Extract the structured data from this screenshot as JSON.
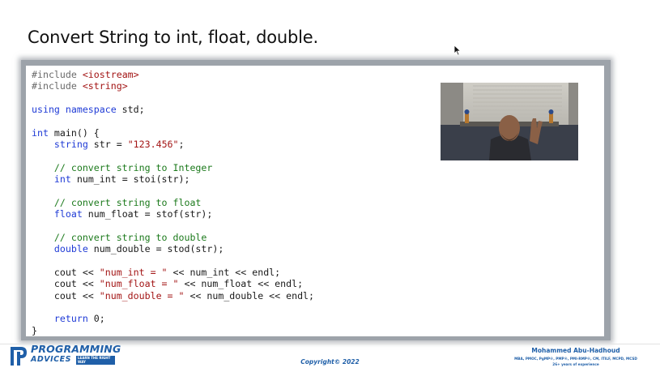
{
  "slide": {
    "title": "Convert String to int, float, double."
  },
  "code": {
    "line1_directive": "#include",
    "line1_header": "<iostream>",
    "line2_directive": "#include",
    "line2_header": "<string>",
    "using_kw": "using namespace",
    "using_rest": " std;",
    "main_kw": "int",
    "main_rest": " main() {",
    "str_type": "string",
    "str_decl": " str = ",
    "str_value": "\"123.456\"",
    "str_end": ";",
    "comment_int": "// convert string to Integer",
    "int_type": "int",
    "int_decl": " num_int = stoi(str);",
    "comment_float": "// convert string to float",
    "float_type": "float",
    "float_decl": " num_float = stof(str);",
    "comment_double": "// convert string to double",
    "double_type": "double",
    "double_decl": " num_double = stod(str);",
    "cout1_a": "cout << ",
    "cout1_str": "\"num_int = \"",
    "cout1_b": " << num_int << endl;",
    "cout2_a": "cout << ",
    "cout2_str": "\"num_float = \"",
    "cout2_b": " << num_float << endl;",
    "cout3_a": "cout << ",
    "cout3_str": "\"num_double = \"",
    "cout3_b": " << num_double << endl;",
    "return_kw": "return",
    "return_rest": " 0;",
    "close_brace": "}"
  },
  "footer": {
    "logo_line1": "PROGRAMMING",
    "logo_line2": "ADVICES",
    "logo_tag": "LEARN THE RIGHT WAY",
    "copyright": "Copyright© 2022",
    "author_name": "Mohammed Abu-Hadhoud",
    "author_credentials": "MBA, PMOC, PgMP®, PMP®, PMI-RMP®, CM, ITILF, MCPD, MCSD",
    "author_experience": "26+ years of experience"
  },
  "colors": {
    "keyword": "#1f3bd6",
    "string": "#a31515",
    "comment": "#1c7a1c",
    "brand": "#1f5fa8"
  },
  "icons": [
    "mouse-pointer-icon",
    "programming-advices-logo-icon"
  ]
}
